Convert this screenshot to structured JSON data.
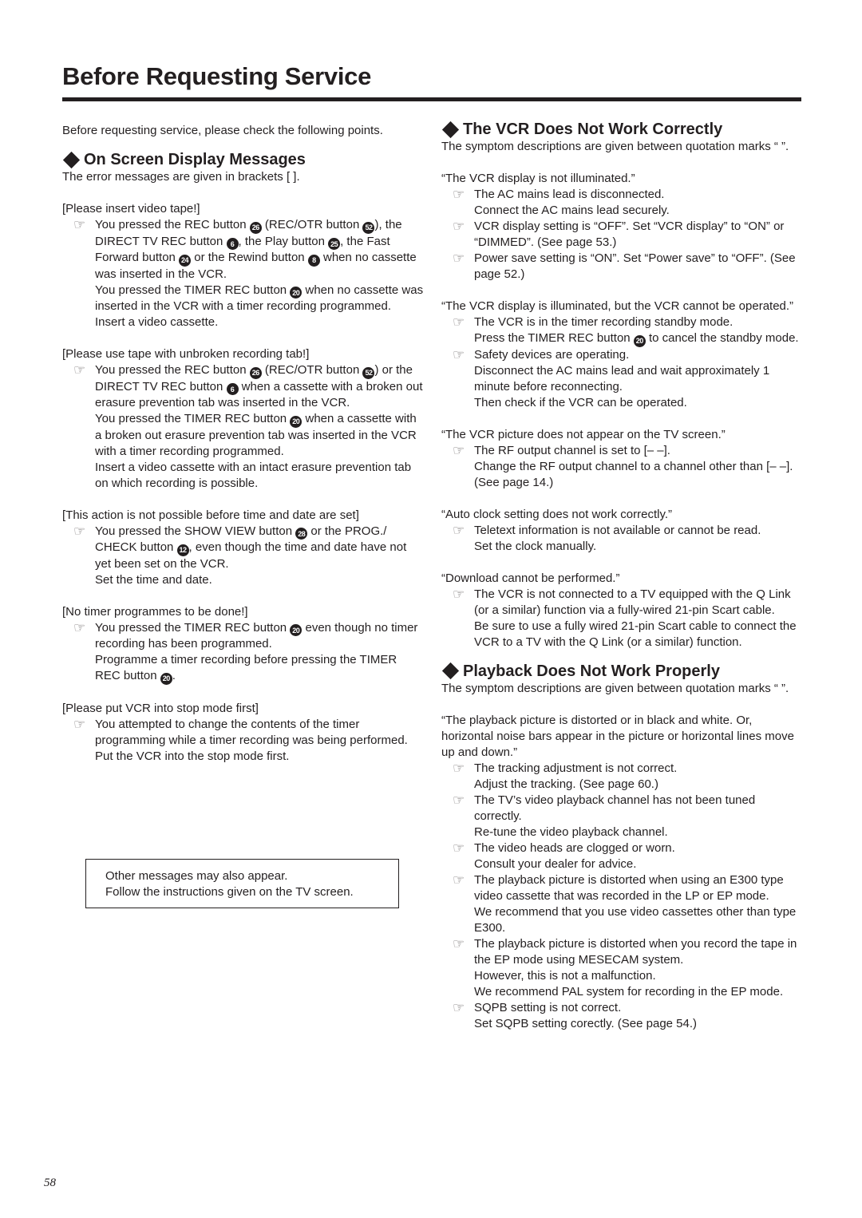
{
  "page": {
    "title": "Before Requesting Service",
    "page_number": "58"
  },
  "icons": {
    "bullet": "pointing-hand-icon",
    "heading_marker": "diamond-icon"
  },
  "left": {
    "intro": "Before requesting service, please check the following points.",
    "section": {
      "heading": "On Screen Display Messages",
      "note": "The error messages are given in brackets [   ]."
    },
    "blocks": [
      {
        "title": "[Please insert video tape!]",
        "items": [
          {
            "lines": [
              "You pressed the REC button ㉖ (REC/OTR button ㊾), the DIRECT TV REC button ❻, the Play button ㉕, the Fast Forward button ㉔ or the Rewind button ❽ when no cassette was inserted in the VCR.",
              "You pressed the TIMER REC button ⑳ when no cassette was inserted in the VCR with a timer recording programmed.",
              "Insert a video cassette."
            ]
          }
        ]
      },
      {
        "title": "[Please use tape with unbroken recording tab!]",
        "items": [
          {
            "lines": [
              "You pressed the REC button ㉖ (REC/OTR button ㊾) or the DIRECT TV REC button ❻ when a cassette with a broken out erasure prevention tab was inserted in the VCR.",
              "You pressed the TIMER REC button ⑳ when a cassette with a broken out erasure prevention tab was inserted in the VCR with a timer recording programmed.",
              "Insert a video cassette with an intact erasure prevention tab on which recording is possible."
            ]
          }
        ]
      },
      {
        "title": "[This action is not possible before time and date are set]",
        "items": [
          {
            "lines": [
              "You pressed the SHOW VIEW button ㉘ or the PROG./ CHECK button ⑫, even though the time and date have not yet been set on the VCR.",
              "Set the time and date."
            ]
          }
        ]
      },
      {
        "title": "[No timer programmes to be done!]",
        "items": [
          {
            "lines": [
              "You pressed the TIMER REC button ⑳ even though no timer recording has been programmed.",
              "Programme a timer recording before pressing the TIMER REC button ⑳."
            ]
          }
        ]
      },
      {
        "title": "[Please put VCR into stop mode first]",
        "items": [
          {
            "lines": [
              "You attempted to change the contents of the timer programming while a timer recording was being performed.",
              "Put the VCR into the stop mode first."
            ]
          }
        ]
      }
    ],
    "note_box": [
      "Other messages may also appear.",
      "Follow the instructions given on the TV screen."
    ]
  },
  "right": {
    "sections": [
      {
        "heading": "The VCR Does Not Work Correctly",
        "note": "The symptom descriptions are given between quotation marks “   ”.",
        "blocks": [
          {
            "title": "“The VCR display is not illuminated.”",
            "items": [
              {
                "lines": [
                  "The AC mains lead is disconnected.",
                  "Connect the AC mains lead securely."
                ]
              },
              {
                "lines": [
                  "VCR display setting is “OFF”.  Set “VCR display” to “ON” or “DIMMED”. (See page 53.)"
                ]
              },
              {
                "lines": [
                  "Power save setting is “ON”.  Set “Power save” to “OFF”. (See page 52.)"
                ]
              }
            ]
          },
          {
            "title": "“The VCR display is illuminated, but the VCR cannot be operated.”",
            "items": [
              {
                "lines": [
                  "The VCR is in the timer recording standby mode.",
                  "Press the TIMER REC button ⑳ to cancel the standby mode."
                ]
              },
              {
                "lines": [
                  "Safety devices are operating.",
                  "Disconnect the AC mains lead and wait approximately 1 minute before reconnecting.",
                  "Then check if the VCR can be operated."
                ]
              }
            ]
          },
          {
            "title": "“The VCR picture does not appear on the TV screen.”",
            "items": [
              {
                "lines": [
                  "The RF output channel is set to [– –].",
                  "Change the RF output channel to a channel other than [– –]. (See page 14.)"
                ]
              }
            ]
          },
          {
            "title": "“Auto clock setting does not work correctly.”",
            "items": [
              {
                "lines": [
                  "Teletext information is not available or cannot be read.",
                  "Set the clock manually."
                ]
              }
            ]
          },
          {
            "title": "“Download cannot be performed.”",
            "items": [
              {
                "lines": [
                  "The VCR is not connected to a TV equipped with the Q Link (or a similar) function via a fully-wired 21-pin Scart cable.",
                  "Be sure to use a fully wired 21-pin Scart cable to connect the VCR to a TV with the Q Link (or a similar) function."
                ]
              }
            ]
          }
        ]
      },
      {
        "heading": "Playback Does Not Work Properly",
        "note": "The symptom descriptions are given between quotation marks “   ”.",
        "blocks": [
          {
            "title": "“The playback picture is distorted or in black and white. Or, horizontal noise bars appear in the picture or horizontal lines move up and down.”",
            "items": [
              {
                "lines": [
                  "The tracking adjustment is not correct.",
                  "Adjust the tracking. (See page 60.)"
                ]
              },
              {
                "lines": [
                  "The TV’s video playback channel has not been tuned correctly.",
                  "Re-tune the video playback channel."
                ]
              },
              {
                "lines": [
                  "The video heads are clogged or worn.",
                  "Consult your dealer for advice."
                ]
              },
              {
                "lines": [
                  "The playback picture is distorted when using an E300 type video cassette that was recorded in the LP or EP mode.",
                  "We recommend that you use video cassettes other than type E300."
                ]
              },
              {
                "lines": [
                  "The playback picture is distorted when you record the tape in the EP mode using MESECAM system.",
                  "However, this is not a malfunction.",
                  "We recommend PAL system for recording in the EP mode."
                ]
              },
              {
                "lines": [
                  "SQPB setting is not correct.",
                  "Set SQPB setting corectly. (See page 54.)"
                ]
              }
            ]
          }
        ]
      }
    ]
  }
}
